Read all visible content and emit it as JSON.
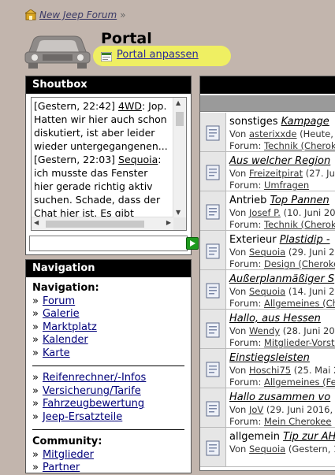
{
  "breadcrumb": {
    "label": "New Jeep Forum",
    "separator": "»"
  },
  "header": {
    "title": "Portal",
    "customize_label": "Portal anpassen"
  },
  "shoutbox": {
    "title": "Shoutbox",
    "messages": [
      {
        "time": "[Gestern, 22:42]",
        "user": "4WD",
        "text": ": Jop. Hatten wir hier auch schon diskutiert, ist aber leider wieder untergegangenen..."
      },
      {
        "time": "[Gestern, 22:03]",
        "user": "Sequoia",
        "text": ": ich musste das Fenster hier gerade richtig aktiv suchen. Schade, dass der Chat hier ist. Es gibt"
      }
    ],
    "input_value": ""
  },
  "navigation": {
    "title": "Navigation",
    "sections": [
      {
        "heading": "Navigation:",
        "items": [
          "Forum",
          "Galerie",
          "Marktplatz",
          "Kalender",
          "Karte"
        ]
      },
      {
        "heading": "",
        "items": [
          "Reifenrechner/-Infos",
          "Versicherung/Tarife",
          "Fahrzeugbewertung",
          "Jeep-Ersatzteile"
        ]
      },
      {
        "heading": "Community:",
        "items": [
          "Mitglieder",
          "Partner"
        ]
      }
    ],
    "bullet": "»"
  },
  "threads": [
    {
      "prefix": "sonstiges ",
      "title": "Kampage",
      "by": "Von ",
      "author": "asterixxde",
      "meta": " (Heute,",
      "forum_label": "Forum: ",
      "forum": "Technik (Cheroke"
    },
    {
      "prefix": "",
      "title": "Aus welcher Region",
      "by": "Von ",
      "author": "Freizeitpirat",
      "meta": " (27. Ju",
      "forum_label": "Forum: ",
      "forum": "Umfragen"
    },
    {
      "prefix": "Antrieb ",
      "title": "Top Pannen",
      "by": "Von ",
      "author": "Josef P.",
      "meta": " (10. Juni 20",
      "forum_label": "Forum: ",
      "forum": "Technik (Cheroke"
    },
    {
      "prefix": "Exterieur ",
      "title": "Plastidip -",
      "by": "Von ",
      "author": "Sequoia",
      "meta": " (29. Juni 2",
      "forum_label": "Forum: ",
      "forum": "Design (Cheroke"
    },
    {
      "prefix": "",
      "title": "Außerplanmäßiger S",
      "by": "Von ",
      "author": "Sequoia",
      "meta": " (14. Juni 2",
      "forum_label": "Forum: ",
      "forum": "Allgemeines (Ch"
    },
    {
      "prefix": "",
      "title": "Hallo, aus Hessen",
      "by": "Von ",
      "author": "Wendy",
      "meta": " (28. Juni 20",
      "forum_label": "Forum: ",
      "forum": "Mitglieder-Vorste"
    },
    {
      "prefix": "",
      "title": "Einstiegsleisten",
      "by": "Von ",
      "author": "Hoschi75",
      "meta": " (25. Mai 2",
      "forum_label": "Forum: ",
      "forum": "Allgemeines (Ferh"
    },
    {
      "prefix": "",
      "title": "Hallo zusammen vo",
      "by": "Von ",
      "author": "JoV",
      "meta": " (29. Juni 2016,",
      "forum_label": "Forum: ",
      "forum": "Mein Cherokee"
    },
    {
      "prefix": "allgemein ",
      "title": "Tip zur AH",
      "by": "Von ",
      "author": "Sequoia",
      "meta": " (Gestern, 1",
      "forum_label": "",
      "forum": ""
    }
  ],
  "colors": {
    "background": "#c2b5ad",
    "header_bar": "#000000",
    "highlight": "#efef62",
    "link": "#00007a",
    "send_button": "#1e9a1e"
  },
  "icons": {
    "home": "home-icon",
    "logo": "jeep-logo",
    "customize": "customize-icon",
    "send": "send-icon",
    "thread": "document-icon"
  }
}
